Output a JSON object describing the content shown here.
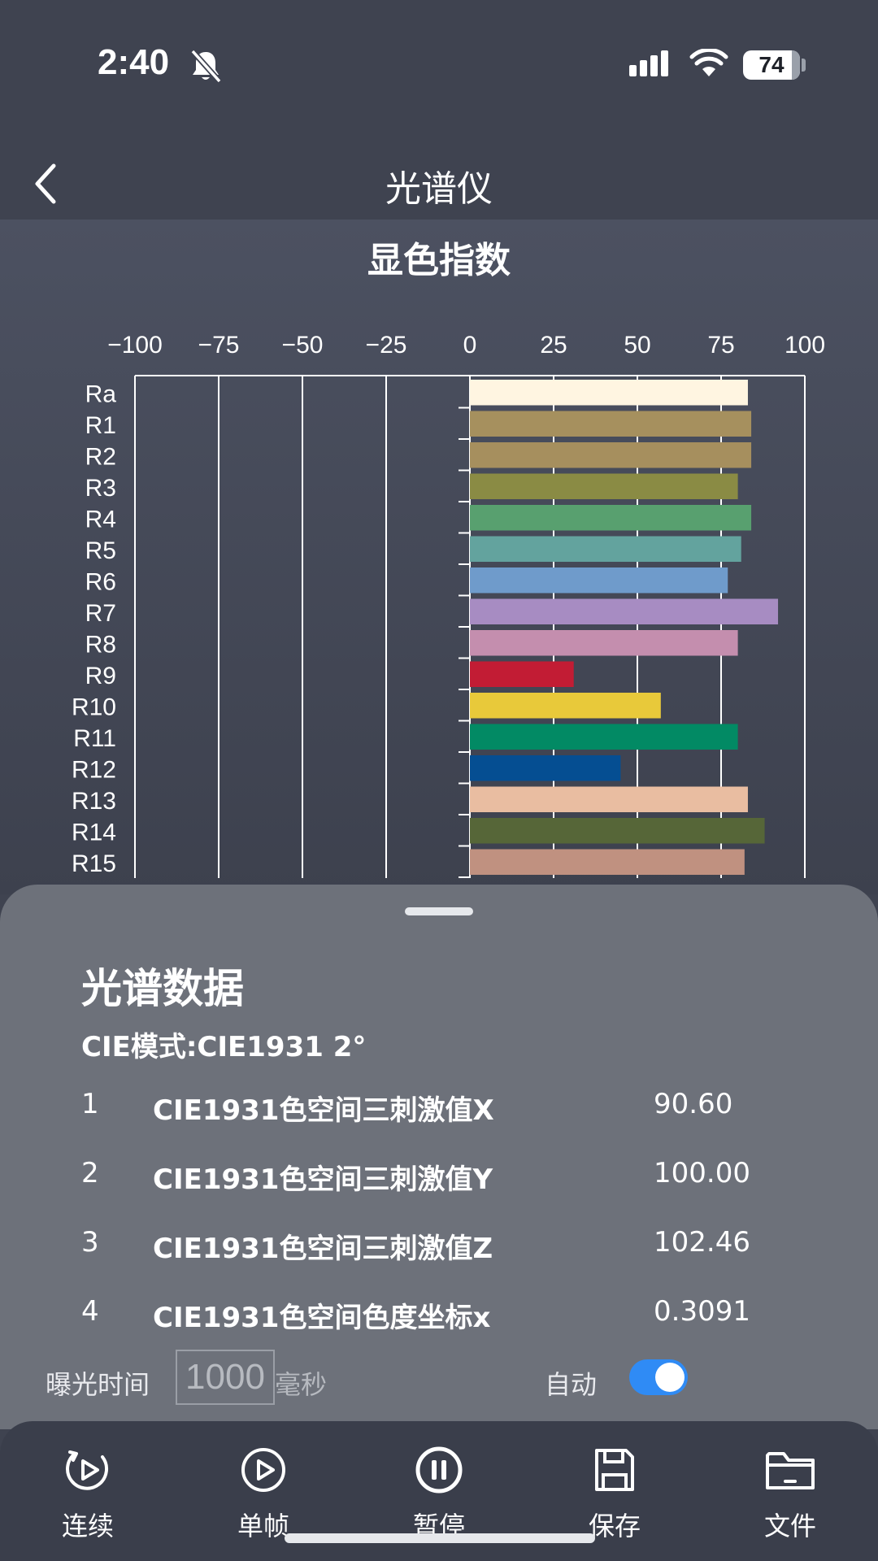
{
  "status_bar": {
    "time": "2:40",
    "battery": "74"
  },
  "nav": {
    "title": "光谱仪"
  },
  "chart_data": {
    "type": "bar",
    "orientation": "horizontal",
    "title": "显色指数",
    "xlim": [
      -100,
      100
    ],
    "xticks": [
      "−100",
      "−75",
      "−50",
      "−25",
      "0",
      "25",
      "50",
      "75",
      "100"
    ],
    "xtick_values": [
      -100,
      -75,
      -50,
      -25,
      0,
      25,
      50,
      75,
      100
    ],
    "grid": true,
    "categories": [
      "Ra",
      "R1",
      "R2",
      "R3",
      "R4",
      "R5",
      "R6",
      "R7",
      "R8",
      "R9",
      "R10",
      "R11",
      "R12",
      "R13",
      "R14",
      "R15"
    ],
    "values": [
      83,
      84,
      84,
      80,
      84,
      81,
      77,
      92,
      80,
      31,
      57,
      80,
      45,
      83,
      88,
      82
    ],
    "colors": [
      "#fff5e1",
      "#a6905e",
      "#a68f5e",
      "#8a8b44",
      "#58a06f",
      "#63a39e",
      "#6f9bcb",
      "#a78cc2",
      "#c48eae",
      "#c21c34",
      "#e8c93a",
      "#028a64",
      "#054e92",
      "#e9bda1",
      "#566638",
      "#c09180"
    ]
  },
  "sheet": {
    "title": "光谱数据",
    "cie_mode": "CIE模式:CIE1931 2°",
    "rows": [
      {
        "index": "1",
        "label": "CIE1931色空间三刺激值X",
        "value": "90.60"
      },
      {
        "index": "2",
        "label": "CIE1931色空间三刺激值Y",
        "value": "100.00"
      },
      {
        "index": "3",
        "label": "CIE1931色空间三刺激值Z",
        "value": "102.46"
      },
      {
        "index": "4",
        "label": "CIE1931色空间色度坐标x",
        "value": "0.3091"
      }
    ],
    "exposure": {
      "label": "曝光时间",
      "value": "1000",
      "unit": "毫秒",
      "auto_label": "自动",
      "auto_on": true
    }
  },
  "tabs": [
    {
      "label": "连续",
      "icon": "continuous-play-icon"
    },
    {
      "label": "单帧",
      "icon": "play-icon"
    },
    {
      "label": "暂停",
      "icon": "pause-icon"
    },
    {
      "label": "保存",
      "icon": "save-icon"
    },
    {
      "label": "文件",
      "icon": "folder-icon"
    }
  ]
}
